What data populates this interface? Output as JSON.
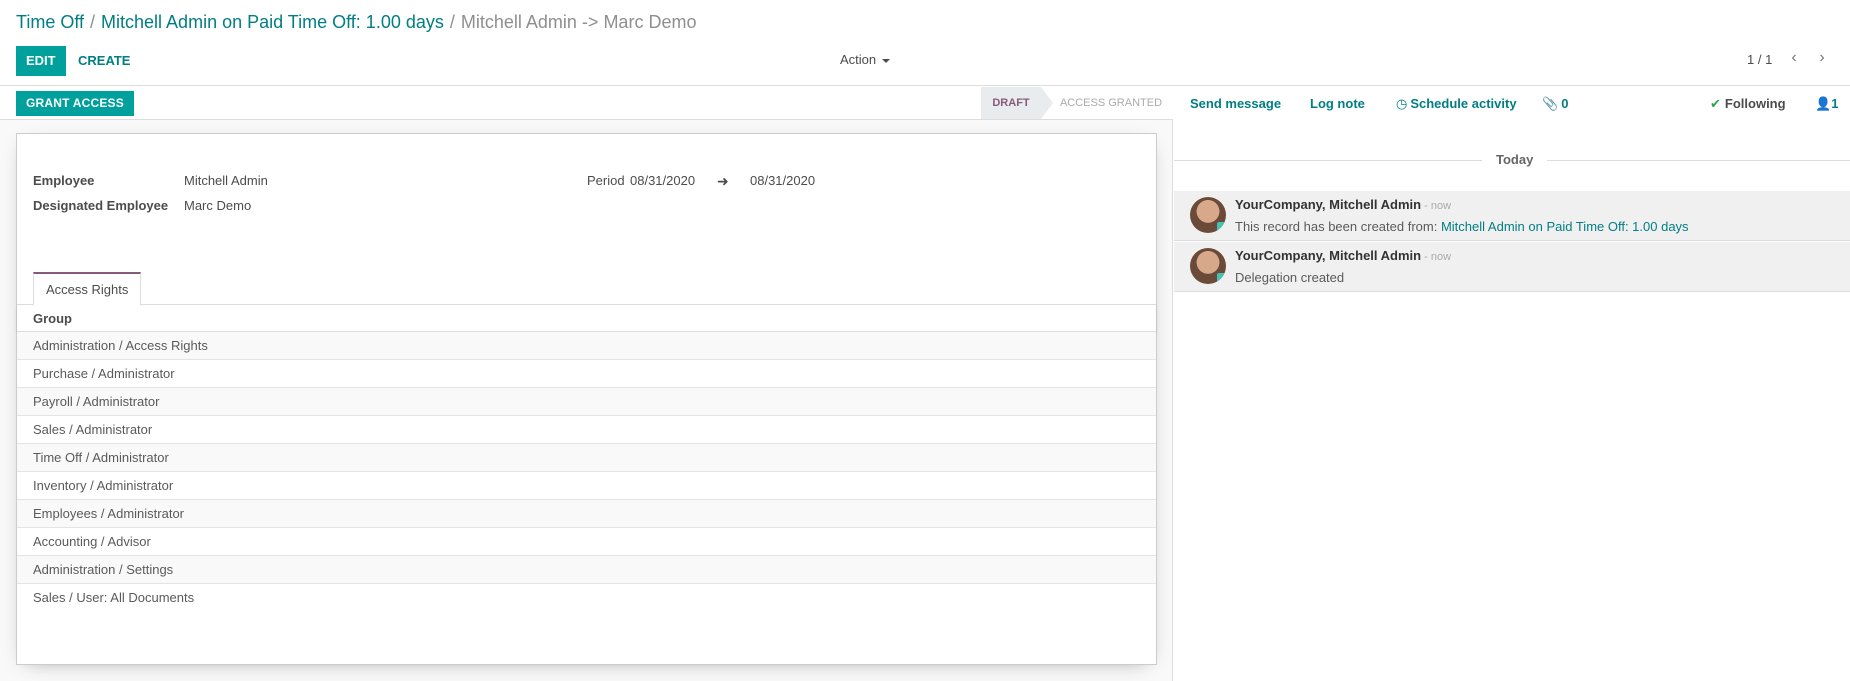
{
  "breadcrumb": {
    "crumb1": "Time Off",
    "crumb2": "Mitchell Admin on Paid Time Off: 1.00 days",
    "current": "Mitchell Admin -> Marc Demo",
    "separator": "/"
  },
  "toolbar": {
    "edit_label": "EDIT",
    "create_label": "CREATE",
    "action_label": "Action",
    "pager": "1 / 1"
  },
  "statusbar": {
    "grant_access_label": "GRANT ACCESS",
    "stages": [
      "DRAFT",
      "ACCESS GRANTED"
    ],
    "active_stage": "DRAFT"
  },
  "form": {
    "employee_label": "Employee",
    "employee_value": "Mitchell Admin",
    "designated_label": "Designated Employee",
    "designated_value": "Marc Demo",
    "period_label": "Period",
    "period_from": "08/31/2020",
    "period_to": "08/31/2020"
  },
  "tabs": [
    "Access Rights"
  ],
  "access_list": {
    "column": "Group",
    "rows": [
      "Administration / Access Rights",
      "Purchase / Administrator",
      "Payroll / Administrator",
      "Sales / Administrator",
      "Time Off / Administrator",
      "Inventory / Administrator",
      "Employees / Administrator",
      "Accounting / Advisor",
      "Administration / Settings",
      "Sales / User: All Documents"
    ]
  },
  "chatter": {
    "send_message": "Send message",
    "log_note": "Log note",
    "schedule_activity": "Schedule activity",
    "attachments_count": "0",
    "following": "Following",
    "followers_count": "1",
    "date_separator": "Today",
    "messages": [
      {
        "author": "YourCompany, Mitchell Admin",
        "date": "- now",
        "body_text": "This record has been created from:",
        "body_link": "Mitchell Admin on Paid Time Off: 1.00 days"
      },
      {
        "author": "YourCompany, Mitchell Admin",
        "date": "- now",
        "body_text": "Delegation created",
        "body_link": ""
      }
    ]
  },
  "colors": {
    "accent": "#00a09d",
    "link": "#017e84",
    "stage_active": "#875a7b",
    "following_check": "#28a745"
  }
}
